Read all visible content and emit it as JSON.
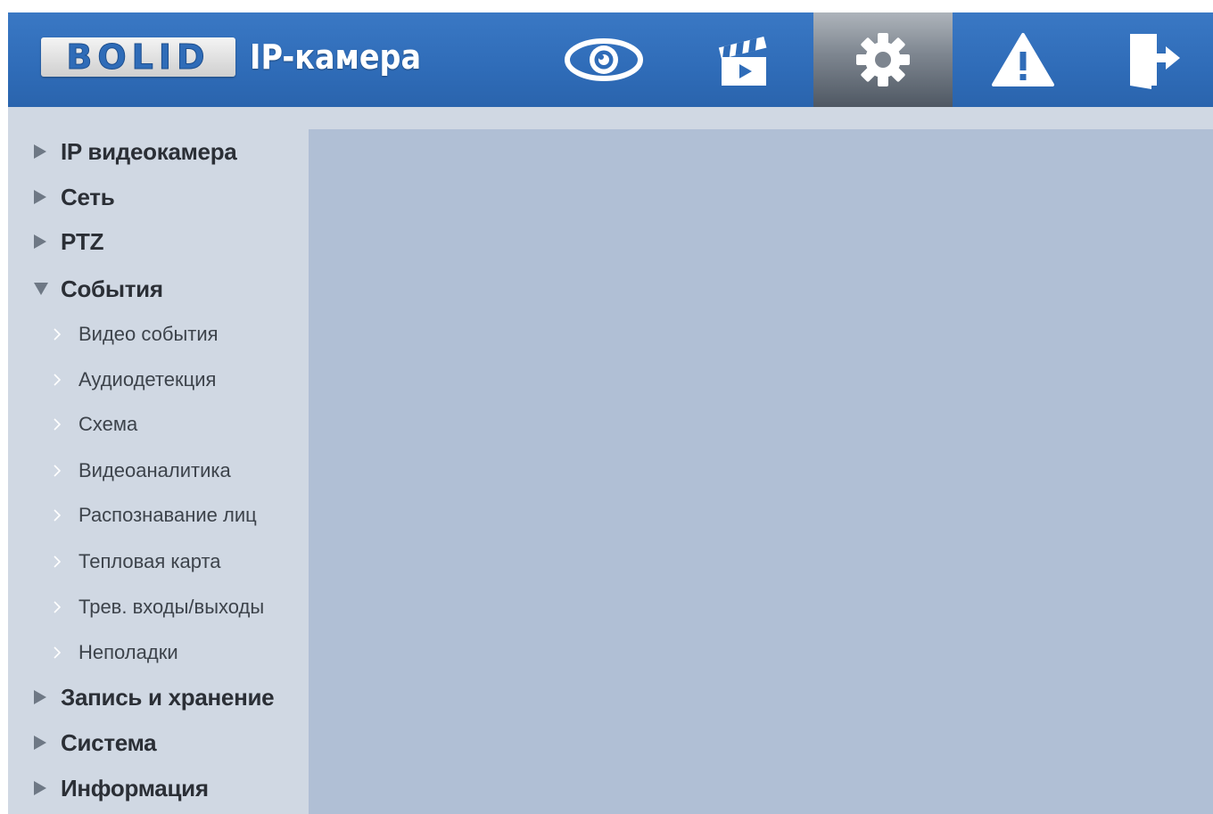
{
  "header": {
    "logo_text": "BOLID",
    "title": "IP-камера",
    "nav": [
      {
        "icon": "eye-icon",
        "name": "live-view"
      },
      {
        "icon": "clapperboard-icon",
        "name": "playback"
      },
      {
        "icon": "gear-icon",
        "name": "settings",
        "active": true
      },
      {
        "icon": "warning-icon",
        "name": "alarm"
      },
      {
        "icon": "logout-icon",
        "name": "logout"
      }
    ],
    "colors": {
      "header_bg": "#2f6cb8",
      "active_tab_bg": "#7d858f"
    }
  },
  "sidebar": {
    "items": [
      {
        "label": "IP видеокамера",
        "expanded": false
      },
      {
        "label": "Сеть",
        "expanded": false
      },
      {
        "label": "PTZ",
        "expanded": false
      },
      {
        "label": "События",
        "expanded": true,
        "children": [
          {
            "label": "Видео события"
          },
          {
            "label": "Аудиодетекция"
          },
          {
            "label": "Схема"
          },
          {
            "label": "Видеоаналитика"
          },
          {
            "label": "Распознавание лиц"
          },
          {
            "label": "Тепловая карта"
          },
          {
            "label": "Трев. входы/выходы"
          },
          {
            "label": "Неполадки"
          }
        ]
      },
      {
        "label": "Запись и хранение",
        "expanded": false
      },
      {
        "label": "Система",
        "expanded": false
      },
      {
        "label": "Информация",
        "expanded": false
      }
    ],
    "colors": {
      "sidebar_bg": "#d0d8e3",
      "content_bg": "#b0bfd5",
      "arrow": "#6e7885",
      "chevron": "#ffffff"
    }
  }
}
